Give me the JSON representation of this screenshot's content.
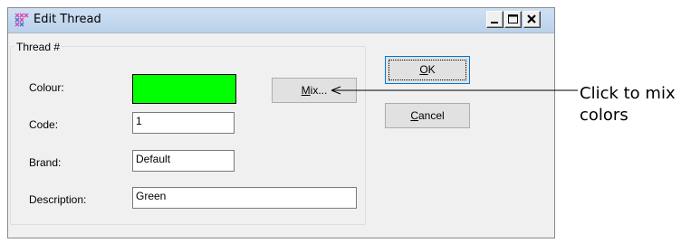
{
  "window": {
    "title": "Edit Thread",
    "controls": {
      "minimize": "minimize-icon",
      "maximize": "maximize-icon",
      "close": "close-icon"
    }
  },
  "group": {
    "label": "Thread #"
  },
  "fields": {
    "colour_label": "Colour:",
    "colour_value": "#00ff00",
    "code_label": "Code:",
    "code_value": "1",
    "brand_label": "Brand:",
    "brand_value": "Default",
    "description_label": "Description:",
    "description_value": "Green"
  },
  "buttons": {
    "mix_mnemonic": "M",
    "mix_rest": "ix...",
    "ok_mnemonic": "O",
    "ok_rest": "K",
    "cancel_mnemonic": "C",
    "cancel_rest": "ancel"
  },
  "callout": {
    "text": "Click to mix colors"
  },
  "colors": {
    "titlebar": "#b9d1ea",
    "swatch": "#00ff00",
    "dialog_bg": "#f0f0f0"
  }
}
